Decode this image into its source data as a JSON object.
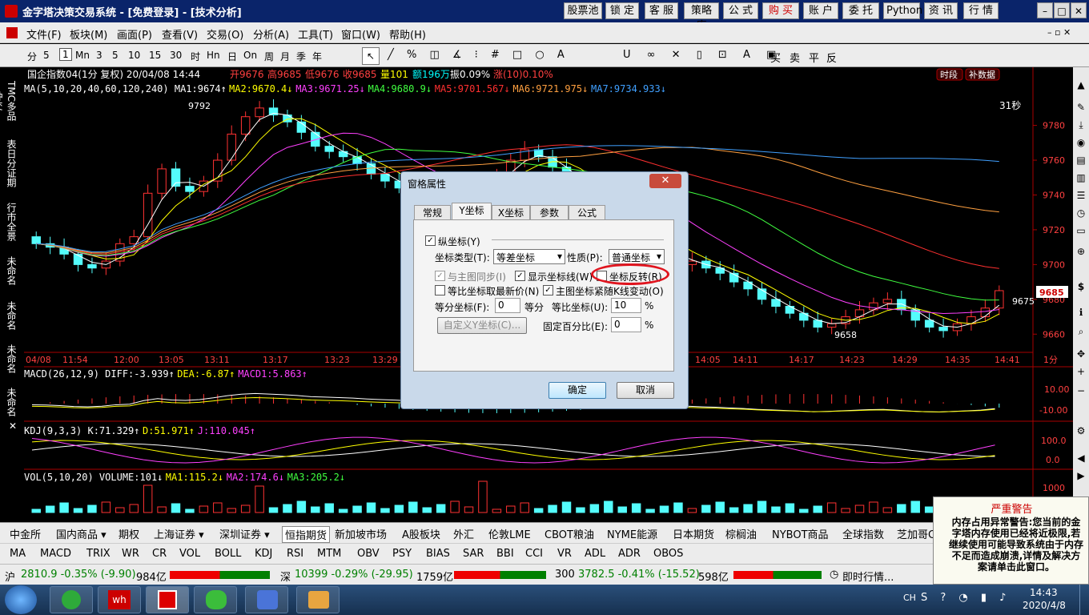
{
  "window": {
    "title": "金字塔决策交易系统 - [免费登录] - [技术分析]",
    "top_buttons": [
      "股票池",
      "锁 定",
      "客 服",
      "策略库",
      "公 式",
      "购 买",
      "账 户",
      "委 托",
      "Python",
      "资 讯",
      "行 情"
    ],
    "controls": [
      "–",
      "□",
      "✕"
    ]
  },
  "menu": [
    "文件(F)",
    "板块(M)",
    "画面(P)",
    "查看(V)",
    "交易(O)",
    "分析(A)",
    "工具(T)",
    "窗口(W)",
    "帮助(H)"
  ],
  "toolbar": {
    "periods": [
      "分",
      "5",
      "1",
      "Mn",
      "3",
      "5",
      "10",
      "15",
      "30",
      "时",
      "Hn",
      "日",
      "On",
      "周",
      "月",
      "季",
      "年"
    ],
    "trade": [
      "买",
      "卖",
      "平",
      "反"
    ]
  },
  "left_tabs": [
    "TMC多品种交",
    "表日分证期",
    "行市全景",
    "未命名",
    "未命名",
    "未命名",
    "未命名"
  ],
  "chart": {
    "header": "国企指数04(1分 复权) 20/04/08 14:44",
    "header_values": [
      {
        "t": "开9676",
        "c": "#ff4040"
      },
      {
        "t": "高9685",
        "c": "#ff4040"
      },
      {
        "t": "低9676",
        "c": "#ff4040"
      },
      {
        "t": "收9685",
        "c": "#ff4040"
      },
      {
        "t": "量101",
        "c": "#ffff00"
      },
      {
        "t": "额196万",
        "c": "#00ffff"
      },
      {
        "t": "振0.09%",
        "c": "#ffffff"
      },
      {
        "t": "涨(10)0.10%",
        "c": "#ff4040"
      }
    ],
    "badges": [
      "时段",
      "补数据"
    ],
    "ma_line": [
      {
        "t": "MA(5,10,20,40,60,120,240) MA1:9674↑",
        "c": "#ffffff"
      },
      {
        "t": "MA2:9670.4↓",
        "c": "#ffff00"
      },
      {
        "t": "MA3:9671.25↓",
        "c": "#ff40ff"
      },
      {
        "t": "MA4:9680.9↓",
        "c": "#40ff40"
      },
      {
        "t": "MA5:9701.567↓",
        "c": "#ff3030"
      },
      {
        "t": "MA6:9721.975↓",
        "c": "#ffa040"
      },
      {
        "t": "MA7:9734.933↓",
        "c": "#40a0ff"
      }
    ],
    "countdown": "31秒",
    "hi_label": "9792",
    "lo_label": "9658",
    "last_label": "9675",
    "last_price": "9685",
    "y_ticks": [
      "9780",
      "9760",
      "9740",
      "9720",
      "9700",
      "9680",
      "9660"
    ],
    "x_ticks": [
      "04/08",
      "11:54",
      "12:00",
      "13:05",
      "13:11",
      "13:17",
      "13:23",
      "13:29",
      "14:05",
      "14:11",
      "14:17",
      "14:23",
      "14:29",
      "14:35",
      "14:41",
      "1分"
    ],
    "macd_header": [
      {
        "t": "MACD(26,12,9) DIFF:-3.939↑",
        "c": "#ffffff"
      },
      {
        "t": "DEA:-6.87↑",
        "c": "#ffff00"
      },
      {
        "t": "MACD1:5.863↑",
        "c": "#ff40ff"
      }
    ],
    "macd_ticks": [
      "10.00",
      "-10.00"
    ],
    "kdj_header": [
      {
        "t": "KDJ(9,3,3) K:71.329↑",
        "c": "#ffffff"
      },
      {
        "t": "D:51.971↑",
        "c": "#ffff00"
      },
      {
        "t": "J:110.045↑",
        "c": "#ff40ff"
      }
    ],
    "kdj_ticks": [
      "100.0",
      "0.0"
    ],
    "vol_header": [
      {
        "t": "VOL(5,10,20) VOLUME:101↓",
        "c": "#ffffff"
      },
      {
        "t": "MA1:115.2↓",
        "c": "#ffff00"
      },
      {
        "t": "MA2:174.6↓",
        "c": "#ff40ff"
      },
      {
        "t": "MA3:205.2↓",
        "c": "#40ff40"
      }
    ],
    "vol_ticks": [
      "1000"
    ]
  },
  "chart_data": {
    "type": "candlestick",
    "y_range": [
      9650,
      9795
    ],
    "closes": [
      9712,
      9710,
      9706,
      9700,
      9698,
      9702,
      9712,
      9716,
      9741,
      9755,
      9745,
      9742,
      9748,
      9760,
      9775,
      9785,
      9790,
      9786,
      9782,
      9776,
      9768,
      9765,
      9762,
      9758,
      9752,
      9748,
      9744,
      9740,
      9738,
      9736,
      9738,
      9742,
      9746,
      9752,
      9760,
      9766,
      9762,
      9756,
      9750,
      9742,
      9738,
      9732,
      9725,
      9718,
      9712,
      9706,
      9700,
      9702,
      9698,
      9695,
      9690,
      9686,
      9680,
      9676,
      9672,
      9668,
      9664,
      9666,
      9670,
      9674,
      9678,
      9680,
      9674,
      9668,
      9664,
      9662,
      9666,
      9670,
      9675,
      9685
    ],
    "ma_series": [
      {
        "name": "MA1",
        "color": "#ffffff"
      },
      {
        "name": "MA2",
        "color": "#ffff00"
      },
      {
        "name": "MA3",
        "color": "#ff40ff"
      },
      {
        "name": "MA4",
        "color": "#40ff40"
      },
      {
        "name": "MA5",
        "color": "#ff3030"
      },
      {
        "name": "MA6",
        "color": "#ffa040"
      },
      {
        "name": "MA7",
        "color": "#40a0ff"
      }
    ]
  },
  "dialog": {
    "title": "窗格属性",
    "tabs": [
      "常规",
      "Y坐标",
      "X坐标",
      "参数",
      "公式"
    ],
    "active_tab": "Y坐标",
    "y_axis_label": "纵坐标(Y)",
    "axis_type_label": "坐标类型(T):",
    "axis_type_value": "等差坐标",
    "nature_label": "性质(P):",
    "nature_value": "普通坐标",
    "sync_label": "与主图同步(I)",
    "show_lines_label": "显示坐标线(W)",
    "invert_label": "坐标反转(R)",
    "latest_label": "等比坐标取最新价(N)",
    "follow_label": "主图坐标紧随K线变动(O)",
    "equal_div_label": "等分坐标(F):",
    "equal_div_value": "0",
    "equal_div_unit": "等分",
    "ratio_label": "等比坐标(U):",
    "ratio_value": "10",
    "ratio_unit": "%",
    "custom_label": "自定义Y坐标(C)...",
    "fixed_pct_label": "固定百分比(E):",
    "fixed_pct_value": "0",
    "fixed_pct_unit": "%",
    "ok_label": "确定",
    "cancel_label": "取消"
  },
  "bottom_tabs": [
    "中金所",
    "国内商品 ▾",
    "期权",
    "上海证券 ▾",
    "深圳证券 ▾",
    "恒指期货",
    "新加坡市场",
    "A股板块",
    "外汇",
    "伦敦LME",
    "CBOT粮油",
    "NYME能源",
    "日本期货",
    "棕榈油",
    "NYBOT商品",
    "全球指数",
    "芝加哥C"
  ],
  "indicator_tabs": [
    "MA",
    "MACD",
    "TRIX",
    "WR",
    "CR",
    "VOL",
    "BOLL",
    "KDJ",
    "RSI",
    "MTM",
    "OBV",
    "PSY",
    "BIAS",
    "SAR",
    "BBI",
    "CCI",
    "VR",
    "ADL",
    "ADR",
    "OBOS"
  ],
  "status": {
    "sh_label": "沪",
    "sh": "2810.9 -0.35% (-9.90)",
    "sh_amt": "984亿",
    "sz_label": "深",
    "sz": "10399 -0.29% (-29.95)",
    "sz_amt": "1759亿",
    "c300_label": "300",
    "c300": "3782.5 -0.41% (-15.52)",
    "c300_amt": "598亿",
    "news": "即时行情..."
  },
  "warning": {
    "title": "严重警告",
    "body": "内存占用异常警告:您当前的金字塔内存使用已经将近极限,若继续使用可能导致系统由于内存不足而造成崩溃,详情及解决方案请单击此窗口。"
  },
  "taskbar": {
    "lang": "CH",
    "time": "14:43",
    "date": "2020/4/8"
  }
}
